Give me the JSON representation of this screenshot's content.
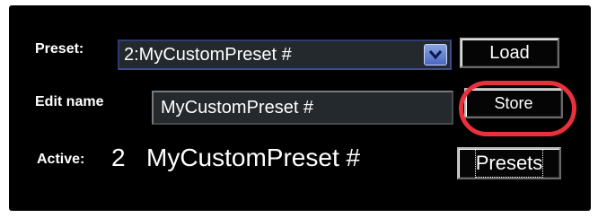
{
  "preset": {
    "label": "Preset:",
    "selected": "2:MyCustomPreset #",
    "load_label": "Load"
  },
  "edit_name": {
    "label": "Edit name",
    "value": "MyCustomPreset #",
    "store_label": "Store"
  },
  "active": {
    "label": "Active:",
    "number": "2",
    "name": "MyCustomPreset #",
    "presets_label": "Presets"
  },
  "colors": {
    "panel_background": "#000000",
    "highlight_ring": "#e8313b",
    "dropdown_arrow": "#4a67c0"
  },
  "icons": {
    "dropdown": "chevron-down-icon"
  }
}
